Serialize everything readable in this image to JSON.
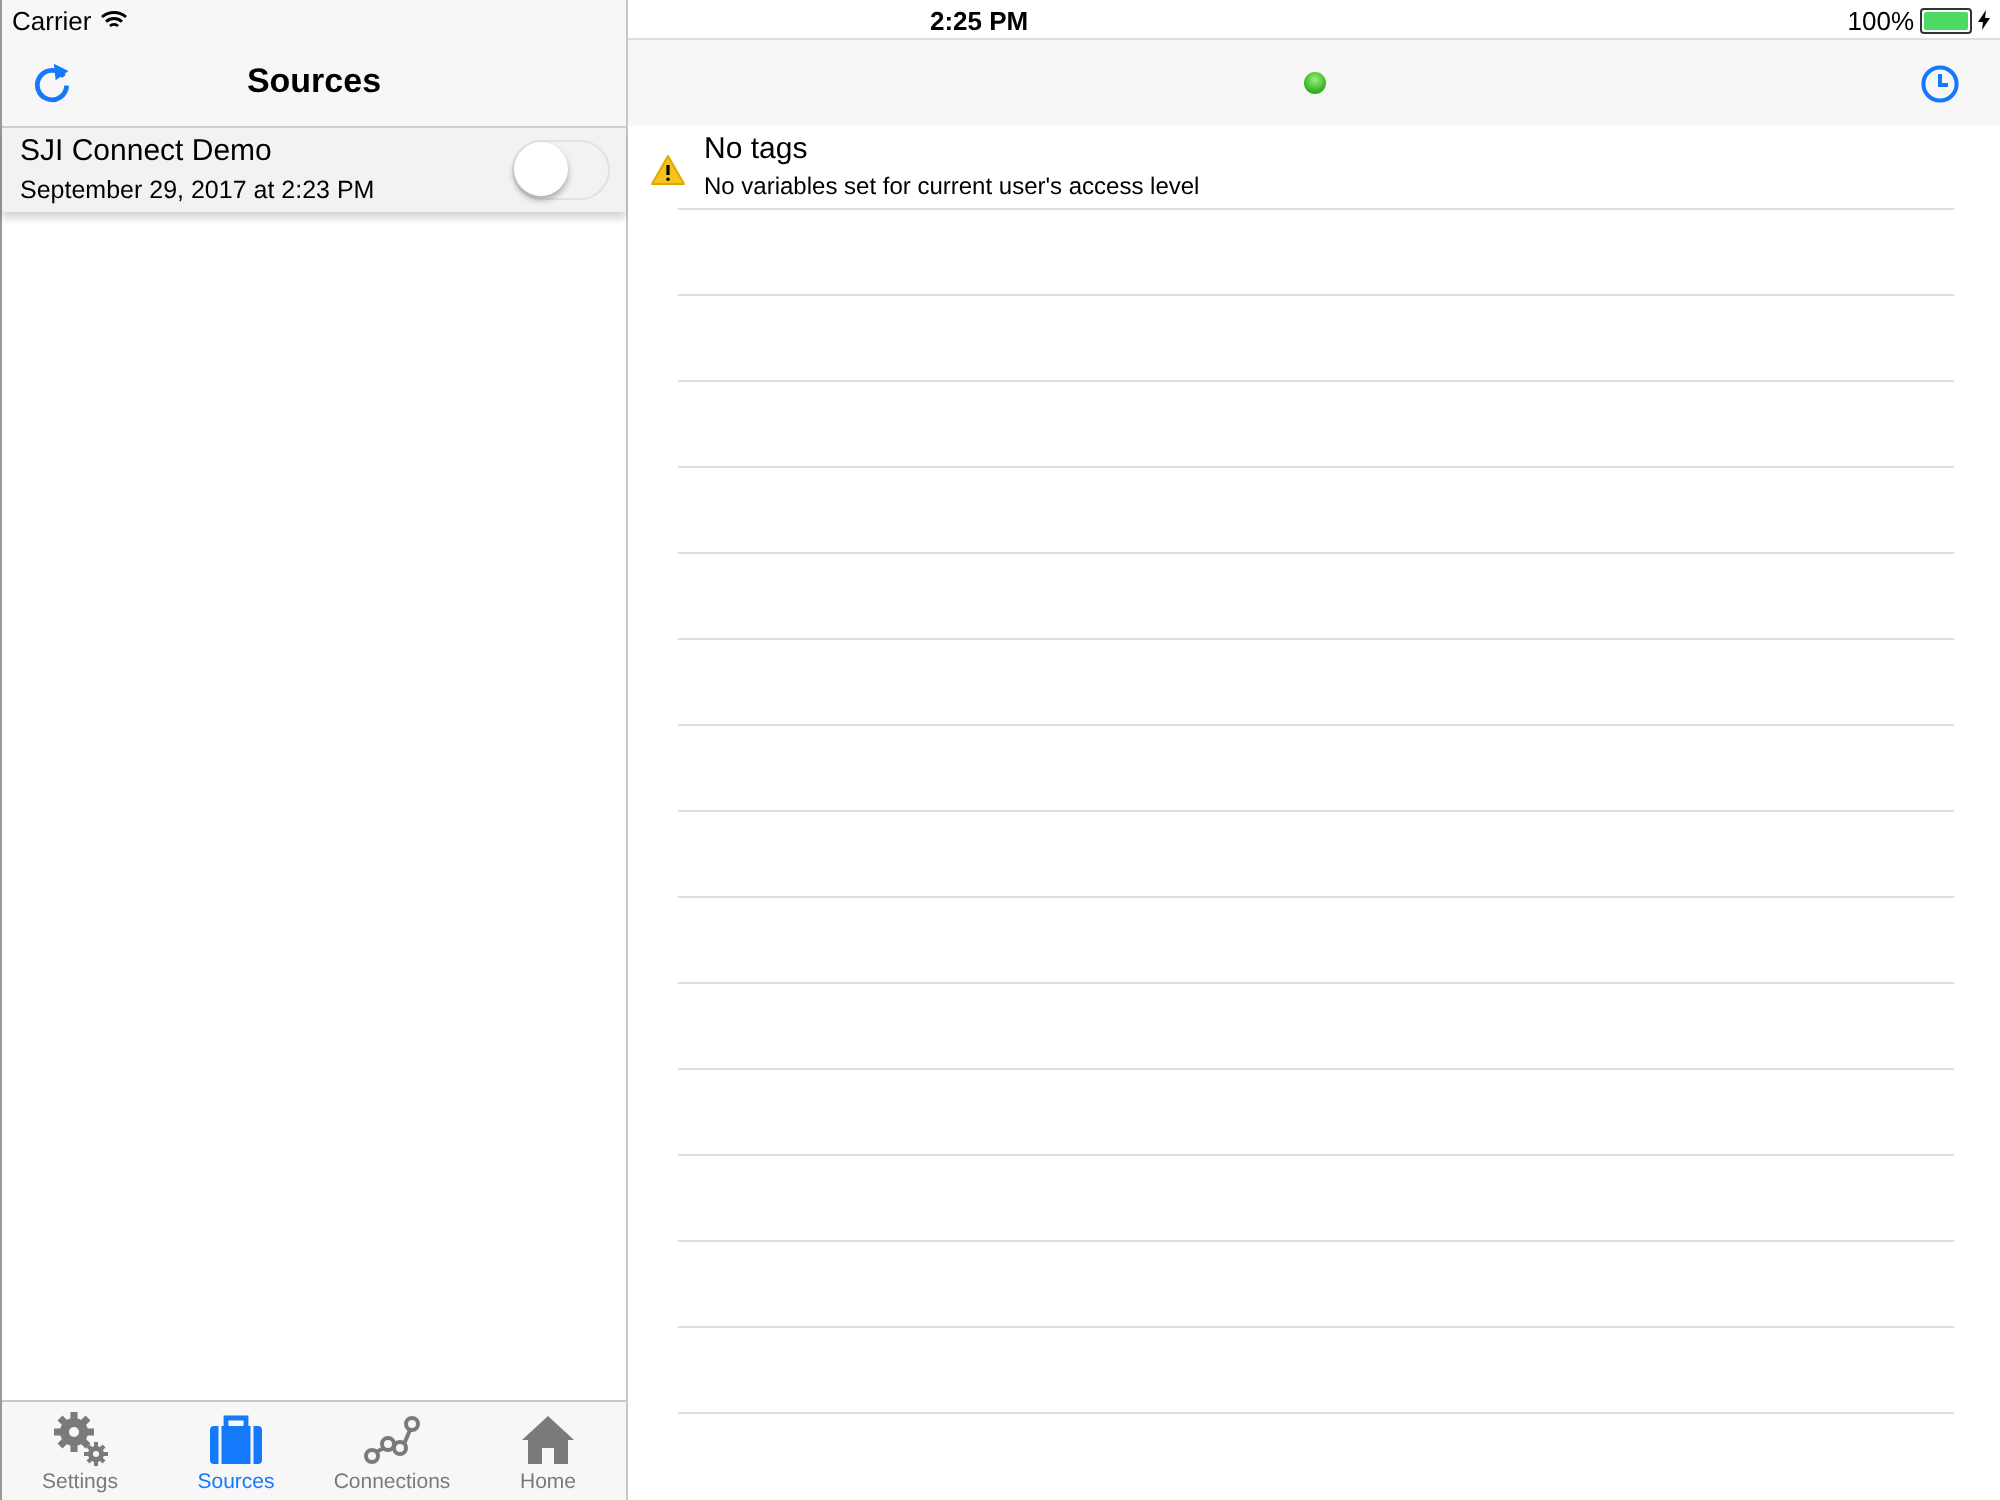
{
  "status_bar": {
    "carrier": "Carrier",
    "time": "2:25 PM",
    "battery": "100%",
    "charging": true
  },
  "sidebar": {
    "title": "Sources",
    "items": [
      {
        "name": "SJI Connect Demo",
        "date": "September 29, 2017 at 2:23 PM",
        "on": false
      }
    ]
  },
  "detail": {
    "message_title": "No tags",
    "message": "No variables set for current user's access level"
  },
  "tab_bar": [
    {
      "kind": "settings",
      "label": "Settings",
      "selected": false
    },
    {
      "kind": "sources",
      "label": "Sources",
      "selected": true
    },
    {
      "kind": "connections",
      "label": "Connections",
      "selected": false
    },
    {
      "kind": "home",
      "label": "Home",
      "selected": false
    }
  ]
}
